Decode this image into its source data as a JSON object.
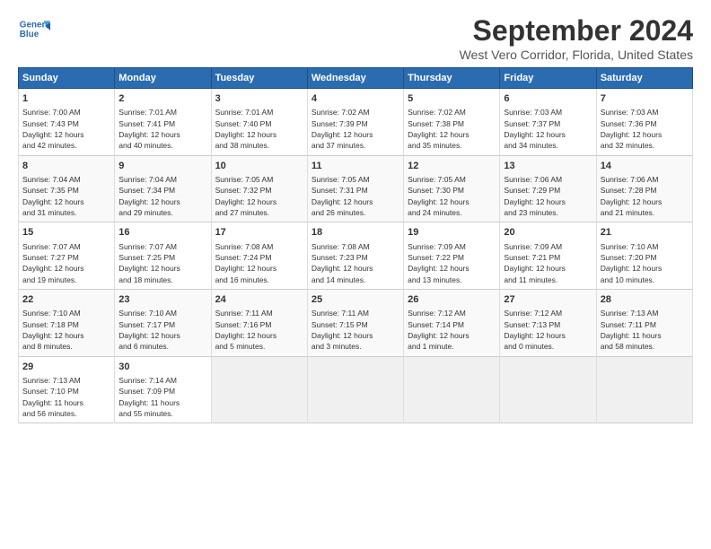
{
  "header": {
    "logo_line1": "General",
    "logo_line2": "Blue",
    "month": "September 2024",
    "location": "West Vero Corridor, Florida, United States"
  },
  "days_of_week": [
    "Sunday",
    "Monday",
    "Tuesday",
    "Wednesday",
    "Thursday",
    "Friday",
    "Saturday"
  ],
  "weeks": [
    [
      {
        "day": "1",
        "lines": [
          "Sunrise: 7:00 AM",
          "Sunset: 7:43 PM",
          "Daylight: 12 hours",
          "and 42 minutes."
        ]
      },
      {
        "day": "2",
        "lines": [
          "Sunrise: 7:01 AM",
          "Sunset: 7:41 PM",
          "Daylight: 12 hours",
          "and 40 minutes."
        ]
      },
      {
        "day": "3",
        "lines": [
          "Sunrise: 7:01 AM",
          "Sunset: 7:40 PM",
          "Daylight: 12 hours",
          "and 38 minutes."
        ]
      },
      {
        "day": "4",
        "lines": [
          "Sunrise: 7:02 AM",
          "Sunset: 7:39 PM",
          "Daylight: 12 hours",
          "and 37 minutes."
        ]
      },
      {
        "day": "5",
        "lines": [
          "Sunrise: 7:02 AM",
          "Sunset: 7:38 PM",
          "Daylight: 12 hours",
          "and 35 minutes."
        ]
      },
      {
        "day": "6",
        "lines": [
          "Sunrise: 7:03 AM",
          "Sunset: 7:37 PM",
          "Daylight: 12 hours",
          "and 34 minutes."
        ]
      },
      {
        "day": "7",
        "lines": [
          "Sunrise: 7:03 AM",
          "Sunset: 7:36 PM",
          "Daylight: 12 hours",
          "and 32 minutes."
        ]
      }
    ],
    [
      {
        "day": "8",
        "lines": [
          "Sunrise: 7:04 AM",
          "Sunset: 7:35 PM",
          "Daylight: 12 hours",
          "and 31 minutes."
        ]
      },
      {
        "day": "9",
        "lines": [
          "Sunrise: 7:04 AM",
          "Sunset: 7:34 PM",
          "Daylight: 12 hours",
          "and 29 minutes."
        ]
      },
      {
        "day": "10",
        "lines": [
          "Sunrise: 7:05 AM",
          "Sunset: 7:32 PM",
          "Daylight: 12 hours",
          "and 27 minutes."
        ]
      },
      {
        "day": "11",
        "lines": [
          "Sunrise: 7:05 AM",
          "Sunset: 7:31 PM",
          "Daylight: 12 hours",
          "and 26 minutes."
        ]
      },
      {
        "day": "12",
        "lines": [
          "Sunrise: 7:05 AM",
          "Sunset: 7:30 PM",
          "Daylight: 12 hours",
          "and 24 minutes."
        ]
      },
      {
        "day": "13",
        "lines": [
          "Sunrise: 7:06 AM",
          "Sunset: 7:29 PM",
          "Daylight: 12 hours",
          "and 23 minutes."
        ]
      },
      {
        "day": "14",
        "lines": [
          "Sunrise: 7:06 AM",
          "Sunset: 7:28 PM",
          "Daylight: 12 hours",
          "and 21 minutes."
        ]
      }
    ],
    [
      {
        "day": "15",
        "lines": [
          "Sunrise: 7:07 AM",
          "Sunset: 7:27 PM",
          "Daylight: 12 hours",
          "and 19 minutes."
        ]
      },
      {
        "day": "16",
        "lines": [
          "Sunrise: 7:07 AM",
          "Sunset: 7:25 PM",
          "Daylight: 12 hours",
          "and 18 minutes."
        ]
      },
      {
        "day": "17",
        "lines": [
          "Sunrise: 7:08 AM",
          "Sunset: 7:24 PM",
          "Daylight: 12 hours",
          "and 16 minutes."
        ]
      },
      {
        "day": "18",
        "lines": [
          "Sunrise: 7:08 AM",
          "Sunset: 7:23 PM",
          "Daylight: 12 hours",
          "and 14 minutes."
        ]
      },
      {
        "day": "19",
        "lines": [
          "Sunrise: 7:09 AM",
          "Sunset: 7:22 PM",
          "Daylight: 12 hours",
          "and 13 minutes."
        ]
      },
      {
        "day": "20",
        "lines": [
          "Sunrise: 7:09 AM",
          "Sunset: 7:21 PM",
          "Daylight: 12 hours",
          "and 11 minutes."
        ]
      },
      {
        "day": "21",
        "lines": [
          "Sunrise: 7:10 AM",
          "Sunset: 7:20 PM",
          "Daylight: 12 hours",
          "and 10 minutes."
        ]
      }
    ],
    [
      {
        "day": "22",
        "lines": [
          "Sunrise: 7:10 AM",
          "Sunset: 7:18 PM",
          "Daylight: 12 hours",
          "and 8 minutes."
        ]
      },
      {
        "day": "23",
        "lines": [
          "Sunrise: 7:10 AM",
          "Sunset: 7:17 PM",
          "Daylight: 12 hours",
          "and 6 minutes."
        ]
      },
      {
        "day": "24",
        "lines": [
          "Sunrise: 7:11 AM",
          "Sunset: 7:16 PM",
          "Daylight: 12 hours",
          "and 5 minutes."
        ]
      },
      {
        "day": "25",
        "lines": [
          "Sunrise: 7:11 AM",
          "Sunset: 7:15 PM",
          "Daylight: 12 hours",
          "and 3 minutes."
        ]
      },
      {
        "day": "26",
        "lines": [
          "Sunrise: 7:12 AM",
          "Sunset: 7:14 PM",
          "Daylight: 12 hours",
          "and 1 minute."
        ]
      },
      {
        "day": "27",
        "lines": [
          "Sunrise: 7:12 AM",
          "Sunset: 7:13 PM",
          "Daylight: 12 hours",
          "and 0 minutes."
        ]
      },
      {
        "day": "28",
        "lines": [
          "Sunrise: 7:13 AM",
          "Sunset: 7:11 PM",
          "Daylight: 11 hours",
          "and 58 minutes."
        ]
      }
    ],
    [
      {
        "day": "29",
        "lines": [
          "Sunrise: 7:13 AM",
          "Sunset: 7:10 PM",
          "Daylight: 11 hours",
          "and 56 minutes."
        ]
      },
      {
        "day": "30",
        "lines": [
          "Sunrise: 7:14 AM",
          "Sunset: 7:09 PM",
          "Daylight: 11 hours",
          "and 55 minutes."
        ]
      },
      {
        "day": "",
        "lines": []
      },
      {
        "day": "",
        "lines": []
      },
      {
        "day": "",
        "lines": []
      },
      {
        "day": "",
        "lines": []
      },
      {
        "day": "",
        "lines": []
      }
    ]
  ]
}
